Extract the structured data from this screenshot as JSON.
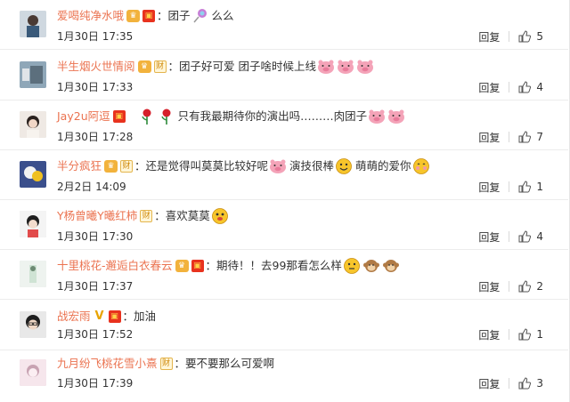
{
  "comments": [
    {
      "user": "爱喝纯净水哦",
      "text": "：团子",
      "text2": "么么",
      "time": "1月30日 17:35",
      "reply": "回复",
      "likes": "5"
    },
    {
      "user": "半生烟火世情阅",
      "text": "：团子好可爱 团子啥时候上线",
      "time": "1月30日 17:33",
      "reply": "回复",
      "likes": "4"
    },
    {
      "user": "Jay2u阿逗",
      "text": "只有我最期待你的演出吗………肉团子",
      "time": "1月30日 17:28",
      "reply": "回复",
      "likes": "7"
    },
    {
      "user": "半分疯狂",
      "text": "：还是觉得叫莫莫比较好呢",
      "text2": "演技很棒",
      "text3": "萌萌的爱你",
      "time": "2月2日 14:09",
      "reply": "回复",
      "likes": "1"
    },
    {
      "user": "Y杨曾曦Y曦红柿",
      "text": "：喜欢莫莫",
      "time": "1月30日 17:30",
      "reply": "回复",
      "likes": "4"
    },
    {
      "user": "十里桃花-邂逅白衣春云",
      "text": "：期待！！去99那看怎么样",
      "time": "1月30日 17:37",
      "reply": "回复",
      "likes": "2"
    },
    {
      "user": "战宏雨",
      "text": "：加油",
      "time": "1月30日 17:52",
      "reply": "回复",
      "likes": "1"
    },
    {
      "user": "九月纷飞桃花雪小熹",
      "text": "：要不要那么可爱啊",
      "time": "1月30日 17:39",
      "reply": "回复",
      "likes": "3"
    }
  ],
  "badges": {
    "level": "♛",
    "red": "▣",
    "cai": "财",
    "verified": "V"
  },
  "colors": {
    "username": "#eb7350",
    "text": "#333333",
    "divider": "#ececec"
  },
  "icons": {
    "like": "thumbs-up-icon",
    "pig": "pig-face-emoji",
    "rose": "rose-emoji",
    "smile": "smile-emoji"
  }
}
